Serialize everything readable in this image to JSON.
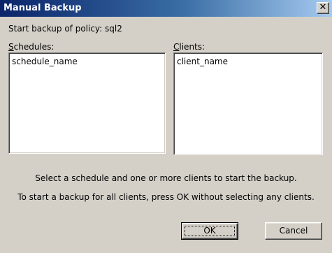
{
  "window": {
    "title": "Manual Backup",
    "close_glyph": "✕",
    "close_icon": "close-icon"
  },
  "policy": {
    "prompt": "Start backup of policy:",
    "name": "sql2"
  },
  "schedules": {
    "label_mnemonic": "S",
    "label_rest": "chedules:",
    "items": [
      "schedule_name"
    ]
  },
  "clients": {
    "label_mnemonic": "C",
    "label_rest": "lients:",
    "items": [
      "client_name"
    ]
  },
  "instructions": {
    "line1": "Select a schedule and one or more clients to start the backup.",
    "line2": "To start a backup for all clients, press OK without selecting any clients."
  },
  "buttons": {
    "ok": "OK",
    "cancel": "Cancel"
  }
}
